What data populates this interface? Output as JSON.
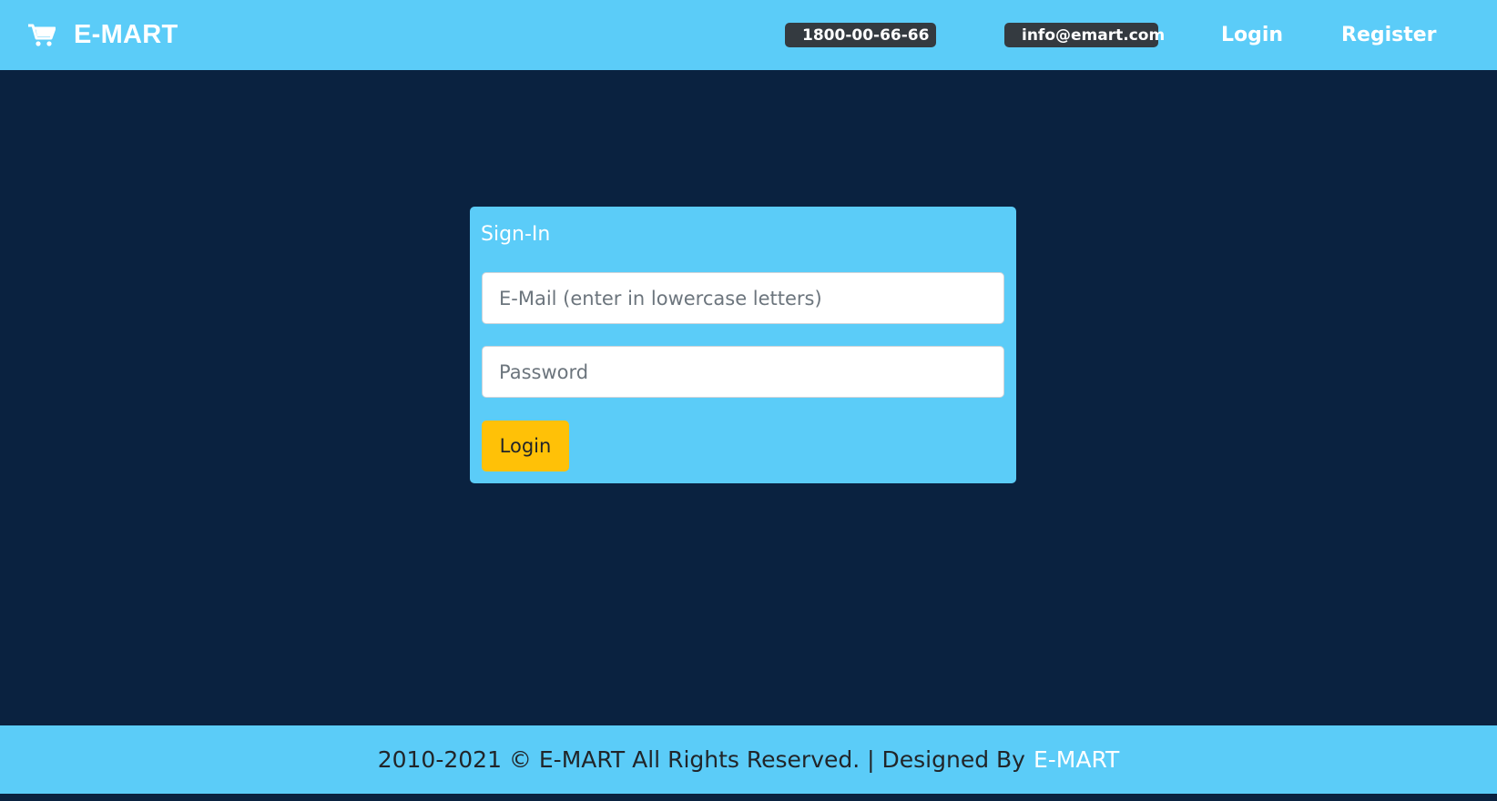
{
  "header": {
    "brand": "E-MART",
    "brand_icon": "cart-icon",
    "phone": "1800-00-66-66",
    "phone_icon": "phone-icon",
    "email": "info@emart.com",
    "nav": {
      "login": "Login",
      "register": "Register"
    }
  },
  "login_card": {
    "title": "Sign-In",
    "email_placeholder": "E-Mail (enter in lowercase letters)",
    "email_value": "",
    "password_placeholder": "Password",
    "password_value": "",
    "submit_label": "Login"
  },
  "footer": {
    "text": "2010-2021 © E-MART All Rights Reserved. | Designed By",
    "link": "E-MART"
  },
  "colors": {
    "primary": "#5bccf8",
    "background": "#0a2240",
    "button": "#ffc107",
    "pill": "#343a40"
  }
}
